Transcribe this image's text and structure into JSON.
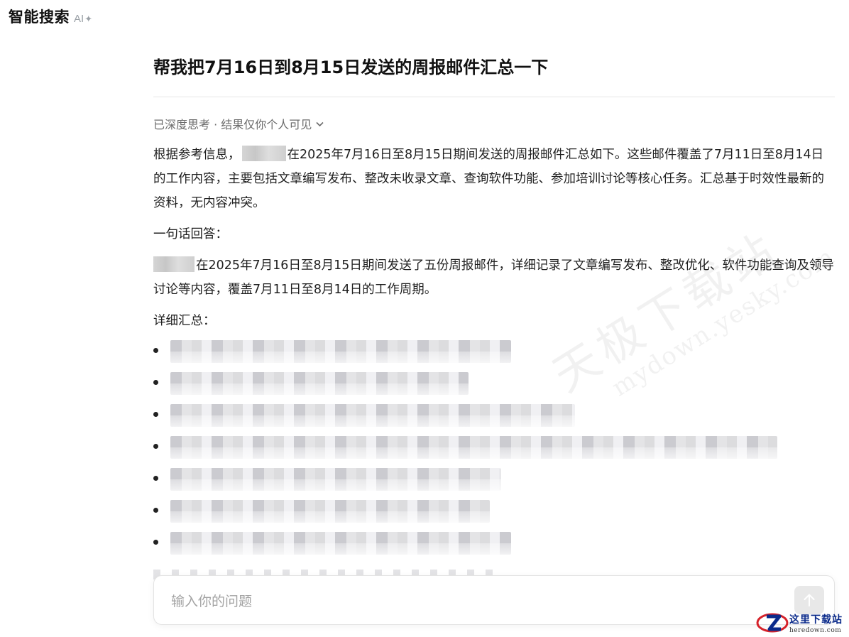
{
  "header": {
    "title": "智能搜索",
    "ai_label": "AI",
    "ai_mark": "✦"
  },
  "query": {
    "title": "帮我把7月16日到8月15日发送的周报邮件汇总一下"
  },
  "thinking": {
    "label": "已深度思考 · 结果仅你个人可见"
  },
  "answer": {
    "intro_before": "根据参考信息，",
    "intro_after": "在2025年7月16日至8月15日期间发送的周报邮件汇总如下。这些邮件覆盖了7月11日至8月14日的工作内容，主要包括文章编写发布、整改未收录文章、查询软件功能、参加培训讨论等核心任务。汇总基于时效性最新的资料，无内容冲突。",
    "one_line_heading": "一句话回答：",
    "one_line_after": "在2025年7月16日至8月15日期间发送了五份周报邮件，详细记录了文章编写发布、整改优化、软件功能查询及领导讨论等内容，覆盖7月11日至8月14日的工作周期。",
    "details_heading": "详细汇总："
  },
  "input": {
    "placeholder": "输入你的问题"
  },
  "watermarks": {
    "center_cn": "天极下载站",
    "center_url": "mydown.yesky.com",
    "corner_cn": "这里下载站",
    "corner_en": "heredown.com"
  },
  "colors": {
    "accent_text": "#111111",
    "muted": "#6b6b6b",
    "placeholder": "#a3a3a3",
    "corner_logo_blue": "#0a2a8a",
    "corner_logo_red": "#d6222a"
  }
}
